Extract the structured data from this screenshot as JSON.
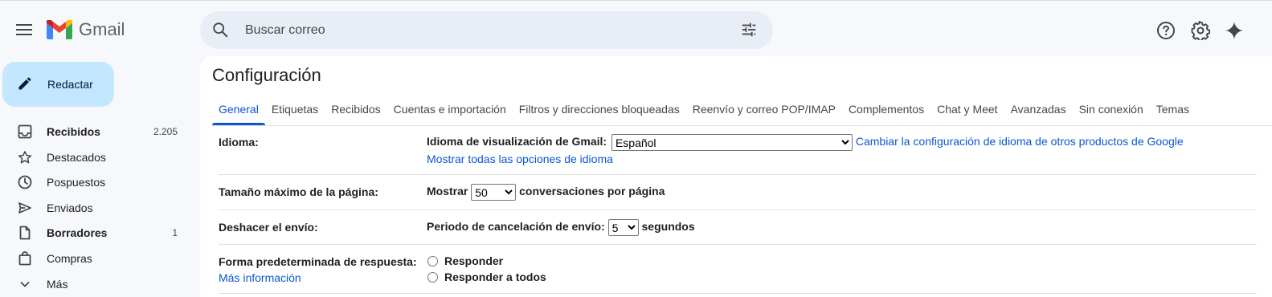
{
  "header": {
    "app_name": "Gmail",
    "search_placeholder": "Buscar correo"
  },
  "icons": {
    "menu": "menu-icon",
    "search": "search-icon",
    "filter": "tune-icon",
    "help": "help-icon",
    "settings": "gear-icon",
    "gemini": "sparkle-icon"
  },
  "compose": {
    "label": "Redactar"
  },
  "sidebar": {
    "items": [
      {
        "label": "Recibidos",
        "count": "2.205",
        "icon": "inbox-icon"
      },
      {
        "label": "Destacados",
        "count": "",
        "icon": "star-icon"
      },
      {
        "label": "Pospuestos",
        "count": "",
        "icon": "clock-icon"
      },
      {
        "label": "Enviados",
        "count": "",
        "icon": "send-icon"
      },
      {
        "label": "Borradores",
        "count": "1",
        "icon": "draft-icon"
      },
      {
        "label": "Compras",
        "count": "",
        "icon": "shopping-bag-icon"
      },
      {
        "label": "Más",
        "count": "",
        "icon": "chevron-down-icon"
      }
    ]
  },
  "settings": {
    "title": "Configuración",
    "tabs": [
      "General",
      "Etiquetas",
      "Recibidos",
      "Cuentas e importación",
      "Filtros y direcciones bloqueadas",
      "Reenvío y correo POP/IMAP",
      "Complementos",
      "Chat y Meet",
      "Avanzadas",
      "Sin conexión",
      "Temas"
    ],
    "active_tab": "General",
    "language": {
      "label": "Idioma:",
      "field_label": "Idioma de visualización de Gmail:",
      "selected": "Español",
      "change_link": "Cambiar la configuración de idioma de otros productos de Google",
      "show_all_link": "Mostrar todas las opciones de idioma"
    },
    "page_size": {
      "label": "Tamaño máximo de la página:",
      "prefix": "Mostrar",
      "selected": "50",
      "suffix": "conversaciones por página"
    },
    "undo_send": {
      "label": "Deshacer el envío:",
      "prefix": "Periodo de cancelación de envío:",
      "selected": "5",
      "suffix": "segundos"
    },
    "reply": {
      "label": "Forma predeterminada de respuesta:",
      "more_info": "Más información",
      "options": [
        "Responder",
        "Responder a todos"
      ]
    }
  },
  "colors": {
    "background": "#f6f8fc",
    "accent": "#0b57d0",
    "compose_bg": "#c2e7ff",
    "search_bg": "#e9eef6"
  }
}
